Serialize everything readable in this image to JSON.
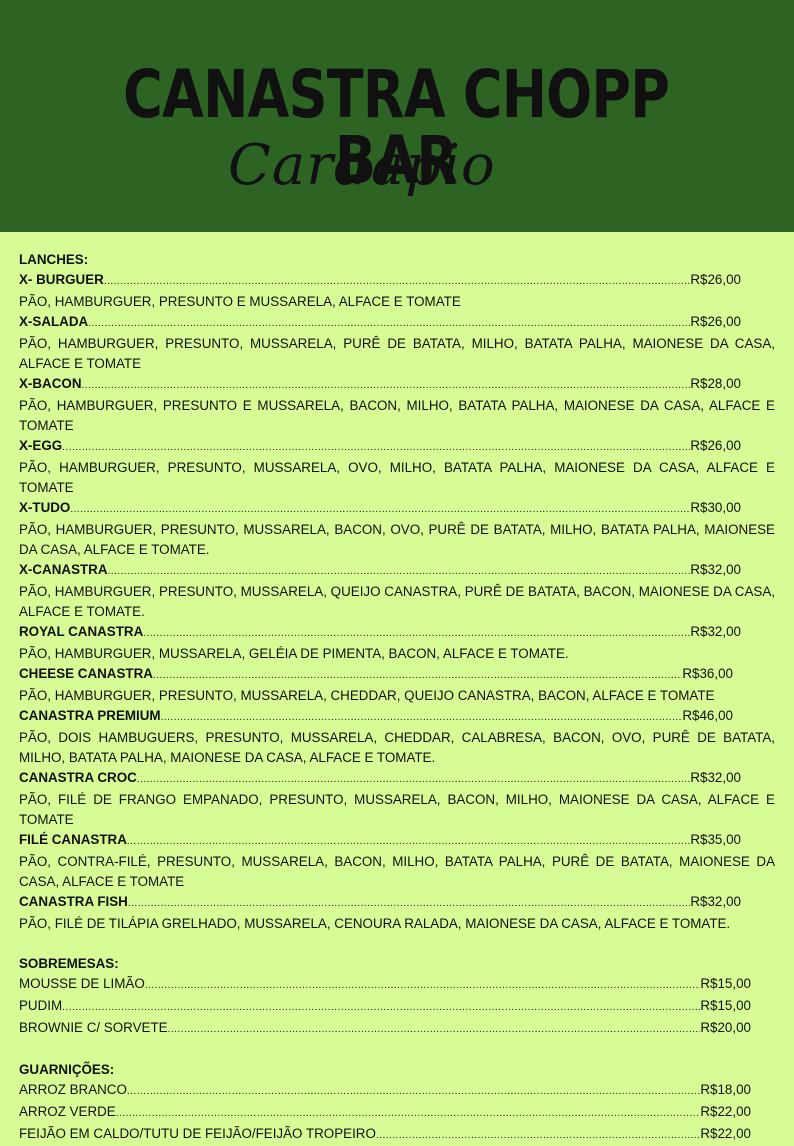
{
  "header": {
    "title": "CANASTRA CHOPP BAR",
    "subtitle": "Cardápio"
  },
  "lanches": {
    "title": "LANCHES:",
    "items": [
      {
        "name": "X- BURGUER",
        "price": "R$26,00",
        "desc": "PÃO, HAMBURGUER, PRESUNTO E MUSSARELA, ALFACE E TOMATE"
      },
      {
        "name": "X-SALADA",
        "price": "R$26,00",
        "desc": "PÃO, HAMBURGUER, PRESUNTO, MUSSARELA, PURÊ DE BATATA, MILHO, BATATA PALHA, MAIONESE DA CASA, ALFACE E TOMATE"
      },
      {
        "name": "X-BACON",
        "price": "R$28,00",
        "desc": "PÃO, HAMBURGUER, PRESUNTO E MUSSARELA, BACON, MILHO, BATATA PALHA, MAIONESE DA CASA, ALFACE E TOMATE"
      },
      {
        "name": "X-EGG",
        "price": "R$26,00",
        "desc": "PÃO, HAMBURGUER, PRESUNTO, MUSSARELA, OVO, MILHO, BATATA PALHA, MAIONESE DA CASA, ALFACE E TOMATE"
      },
      {
        "name": "X-TUDO",
        "price": "R$30,00",
        "desc": "PÃO, HAMBURGUER, PRESUNTO, MUSSARELA, BACON, OVO, PURÊ DE BATATA, MILHO, BATATA PALHA, MAIONESE DA CASA, ALFACE E TOMATE."
      },
      {
        "name": "X-CANASTRA",
        "price": "R$32,00",
        "desc": "PÃO, HAMBURGUER, PRESUNTO, MUSSARELA, QUEIJO CANASTRA, PURÊ DE BATATA, BACON, MAIONESE DA CASA, ALFACE E TOMATE."
      },
      {
        "name": "ROYAL CANASTRA",
        "price": "R$32,00",
        "desc": "PÃO, HAMBURGUER, MUSSARELA, GELÉIA DE PIMENTA, BACON, ALFACE E TOMATE."
      },
      {
        "name": "CHEESE CANASTRA",
        "price": "R$36,00",
        "desc": "PÃO, HAMBURGUER, PRESUNTO, MUSSARELA, CHEDDAR, QUEIJO CANASTRA, BACON, ALFACE E TOMATE"
      },
      {
        "name": "CANASTRA PREMIUM",
        "price": "R$46,00",
        "desc": "PÃO, DOIS HAMBUGUERS, PRESUNTO, MUSSARELA, CHEDDAR, CALABRESA, BACON, OVO, PURÊ DE BATATA, MILHO, BATATA PALHA, MAIONESE DA CASA, ALFACE E TOMATE."
      },
      {
        "name": "CANASTRA CROC",
        "price": "R$32,00",
        "desc": "PÃO, FILÉ DE FRANGO EMPANADO, PRESUNTO, MUSSARELA, BACON, MILHO, MAIONESE DA CASA, ALFACE E TOMATE"
      },
      {
        "name": "FILÉ CANASTRA",
        "price": "R$35,00",
        "desc": "PÃO, CONTRA-FILÉ, PRESUNTO, MUSSARELA, BACON, MILHO, BATATA PALHA, PURÊ DE BATATA, MAIONESE DA CASA, ALFACE E TOMATE"
      },
      {
        "name": "CANASTRA FISH",
        "price": "R$32,00",
        "desc": "PÃO, FILÉ DE TILÁPIA GRELHADO, MUSSARELA, CENOURA RALADA, MAIONESE DA CASA, ALFACE E TOMATE."
      }
    ]
  },
  "sobremesas": {
    "title": "SOBREMESAS:",
    "items": [
      {
        "name": "MOUSSE DE LIMÃO",
        "price": "R$15,00"
      },
      {
        "name": "PUDIM",
        "price": "R$15,00"
      },
      {
        "name": "BROWNIE C/ SORVETE",
        "price": "R$20,00"
      }
    ]
  },
  "guarnicoes": {
    "title": "GUARNIÇÕES:",
    "items": [
      {
        "name": "ARROZ BRANCO",
        "price": "R$18,00"
      },
      {
        "name": "ARROZ VERDE",
        "price": "R$22,00"
      },
      {
        "name": "FEIJÃO EM CALDO/TUTU DE FEIJÃO/FEIJÃO TROPEIRO",
        "price": "R$22,00"
      }
    ]
  },
  "colors": {
    "header_green": "#2d6424",
    "page_background": "#d7fc96"
  }
}
